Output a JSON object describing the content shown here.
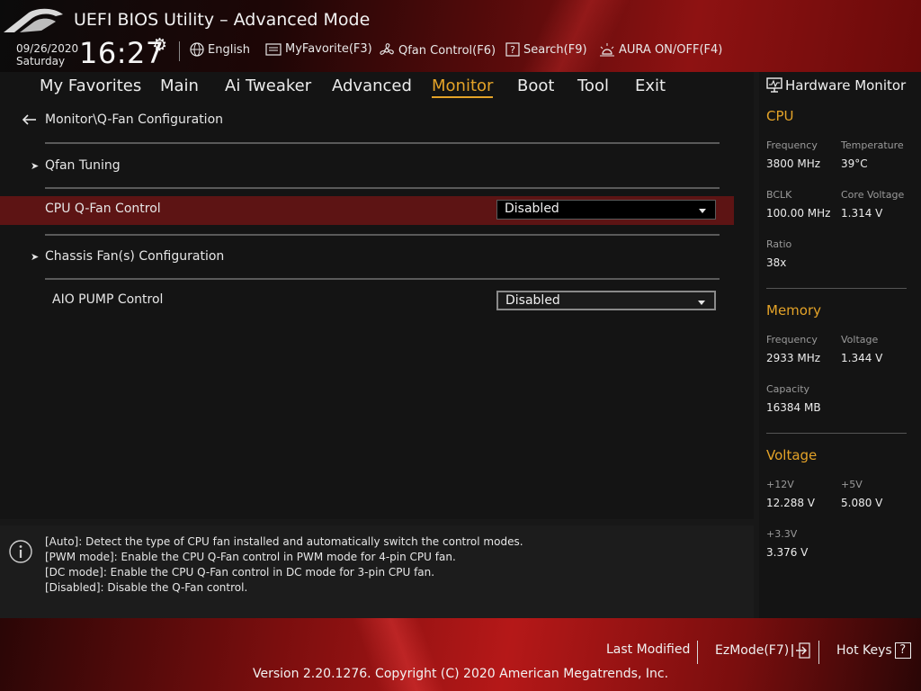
{
  "header": {
    "title": "UEFI BIOS Utility – Advanced Mode",
    "date": "09/26/2020",
    "day": "Saturday",
    "time": "16:27",
    "toolbar": {
      "language": "English",
      "favorite": "MyFavorite(F3)",
      "qfan": "Qfan Control(F6)",
      "search": "Search(F9)",
      "aura": "AURA ON/OFF(F4)"
    }
  },
  "nav": {
    "tabs": [
      "My Favorites",
      "Main",
      "Ai Tweaker",
      "Advanced",
      "Monitor",
      "Boot",
      "Tool",
      "Exit"
    ],
    "active_tab": "Monitor"
  },
  "main": {
    "breadcrumb": "Monitor\\Q-Fan Configuration",
    "items": {
      "qfan_tuning": "Qfan Tuning",
      "cpu_qfan_label": "CPU Q-Fan Control",
      "cpu_qfan_value": "Disabled",
      "chassis_fan": "Chassis Fan(s) Configuration",
      "aio_label": "AIO PUMP Control",
      "aio_value": "Disabled"
    }
  },
  "help": {
    "lines": [
      "[Auto]: Detect the type of CPU fan installed and automatically switch the control modes.",
      "[PWM mode]: Enable the CPU Q-Fan control in PWM mode for 4-pin CPU fan.",
      "[DC mode]: Enable the CPU Q-Fan control in DC mode for 3-pin CPU fan.",
      "[Disabled]: Disable the Q-Fan control."
    ]
  },
  "hardware_monitor": {
    "title": "Hardware Monitor",
    "cpu": {
      "heading": "CPU",
      "frequency_label": "Frequency",
      "frequency": "3800 MHz",
      "temperature_label": "Temperature",
      "temperature": "39°C",
      "bclk_label": "BCLK",
      "bclk": "100.00 MHz",
      "core_voltage_label": "Core Voltage",
      "core_voltage": "1.314 V",
      "ratio_label": "Ratio",
      "ratio": "38x"
    },
    "memory": {
      "heading": "Memory",
      "frequency_label": "Frequency",
      "frequency": "2933 MHz",
      "voltage_label": "Voltage",
      "voltage": "1.344 V",
      "capacity_label": "Capacity",
      "capacity": "16384 MB"
    },
    "voltage": {
      "heading": "Voltage",
      "v12_label": "+12V",
      "v12": "12.288 V",
      "v5_label": "+5V",
      "v5": "5.080 V",
      "v33_label": "+3.3V",
      "v33": "3.376 V"
    }
  },
  "footer": {
    "last_modified": "Last Modified",
    "ezmode": "EzMode(F7)",
    "hotkeys": "Hot Keys",
    "hotkeys_icon": "?",
    "version": "Version 2.20.1276. Copyright (C) 2020 American Megatrends, Inc."
  },
  "colors": {
    "accent": "#e4a328",
    "selected_row": "#5d1414",
    "header_red": "#8e1212"
  }
}
